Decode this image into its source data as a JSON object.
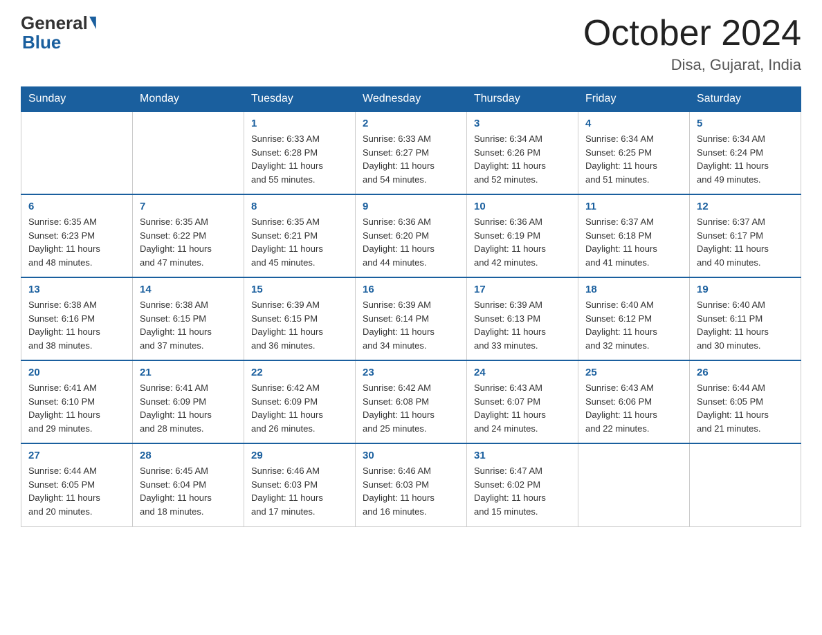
{
  "header": {
    "logo_general": "General",
    "logo_blue": "Blue",
    "month_title": "October 2024",
    "location": "Disa, Gujarat, India"
  },
  "weekdays": [
    "Sunday",
    "Monday",
    "Tuesday",
    "Wednesday",
    "Thursday",
    "Friday",
    "Saturday"
  ],
  "weeks": [
    [
      {
        "day": "",
        "info": ""
      },
      {
        "day": "",
        "info": ""
      },
      {
        "day": "1",
        "info": "Sunrise: 6:33 AM\nSunset: 6:28 PM\nDaylight: 11 hours\nand 55 minutes."
      },
      {
        "day": "2",
        "info": "Sunrise: 6:33 AM\nSunset: 6:27 PM\nDaylight: 11 hours\nand 54 minutes."
      },
      {
        "day": "3",
        "info": "Sunrise: 6:34 AM\nSunset: 6:26 PM\nDaylight: 11 hours\nand 52 minutes."
      },
      {
        "day": "4",
        "info": "Sunrise: 6:34 AM\nSunset: 6:25 PM\nDaylight: 11 hours\nand 51 minutes."
      },
      {
        "day": "5",
        "info": "Sunrise: 6:34 AM\nSunset: 6:24 PM\nDaylight: 11 hours\nand 49 minutes."
      }
    ],
    [
      {
        "day": "6",
        "info": "Sunrise: 6:35 AM\nSunset: 6:23 PM\nDaylight: 11 hours\nand 48 minutes."
      },
      {
        "day": "7",
        "info": "Sunrise: 6:35 AM\nSunset: 6:22 PM\nDaylight: 11 hours\nand 47 minutes."
      },
      {
        "day": "8",
        "info": "Sunrise: 6:35 AM\nSunset: 6:21 PM\nDaylight: 11 hours\nand 45 minutes."
      },
      {
        "day": "9",
        "info": "Sunrise: 6:36 AM\nSunset: 6:20 PM\nDaylight: 11 hours\nand 44 minutes."
      },
      {
        "day": "10",
        "info": "Sunrise: 6:36 AM\nSunset: 6:19 PM\nDaylight: 11 hours\nand 42 minutes."
      },
      {
        "day": "11",
        "info": "Sunrise: 6:37 AM\nSunset: 6:18 PM\nDaylight: 11 hours\nand 41 minutes."
      },
      {
        "day": "12",
        "info": "Sunrise: 6:37 AM\nSunset: 6:17 PM\nDaylight: 11 hours\nand 40 minutes."
      }
    ],
    [
      {
        "day": "13",
        "info": "Sunrise: 6:38 AM\nSunset: 6:16 PM\nDaylight: 11 hours\nand 38 minutes."
      },
      {
        "day": "14",
        "info": "Sunrise: 6:38 AM\nSunset: 6:15 PM\nDaylight: 11 hours\nand 37 minutes."
      },
      {
        "day": "15",
        "info": "Sunrise: 6:39 AM\nSunset: 6:15 PM\nDaylight: 11 hours\nand 36 minutes."
      },
      {
        "day": "16",
        "info": "Sunrise: 6:39 AM\nSunset: 6:14 PM\nDaylight: 11 hours\nand 34 minutes."
      },
      {
        "day": "17",
        "info": "Sunrise: 6:39 AM\nSunset: 6:13 PM\nDaylight: 11 hours\nand 33 minutes."
      },
      {
        "day": "18",
        "info": "Sunrise: 6:40 AM\nSunset: 6:12 PM\nDaylight: 11 hours\nand 32 minutes."
      },
      {
        "day": "19",
        "info": "Sunrise: 6:40 AM\nSunset: 6:11 PM\nDaylight: 11 hours\nand 30 minutes."
      }
    ],
    [
      {
        "day": "20",
        "info": "Sunrise: 6:41 AM\nSunset: 6:10 PM\nDaylight: 11 hours\nand 29 minutes."
      },
      {
        "day": "21",
        "info": "Sunrise: 6:41 AM\nSunset: 6:09 PM\nDaylight: 11 hours\nand 28 minutes."
      },
      {
        "day": "22",
        "info": "Sunrise: 6:42 AM\nSunset: 6:09 PM\nDaylight: 11 hours\nand 26 minutes."
      },
      {
        "day": "23",
        "info": "Sunrise: 6:42 AM\nSunset: 6:08 PM\nDaylight: 11 hours\nand 25 minutes."
      },
      {
        "day": "24",
        "info": "Sunrise: 6:43 AM\nSunset: 6:07 PM\nDaylight: 11 hours\nand 24 minutes."
      },
      {
        "day": "25",
        "info": "Sunrise: 6:43 AM\nSunset: 6:06 PM\nDaylight: 11 hours\nand 22 minutes."
      },
      {
        "day": "26",
        "info": "Sunrise: 6:44 AM\nSunset: 6:05 PM\nDaylight: 11 hours\nand 21 minutes."
      }
    ],
    [
      {
        "day": "27",
        "info": "Sunrise: 6:44 AM\nSunset: 6:05 PM\nDaylight: 11 hours\nand 20 minutes."
      },
      {
        "day": "28",
        "info": "Sunrise: 6:45 AM\nSunset: 6:04 PM\nDaylight: 11 hours\nand 18 minutes."
      },
      {
        "day": "29",
        "info": "Sunrise: 6:46 AM\nSunset: 6:03 PM\nDaylight: 11 hours\nand 17 minutes."
      },
      {
        "day": "30",
        "info": "Sunrise: 6:46 AM\nSunset: 6:03 PM\nDaylight: 11 hours\nand 16 minutes."
      },
      {
        "day": "31",
        "info": "Sunrise: 6:47 AM\nSunset: 6:02 PM\nDaylight: 11 hours\nand 15 minutes."
      },
      {
        "day": "",
        "info": ""
      },
      {
        "day": "",
        "info": ""
      }
    ]
  ]
}
